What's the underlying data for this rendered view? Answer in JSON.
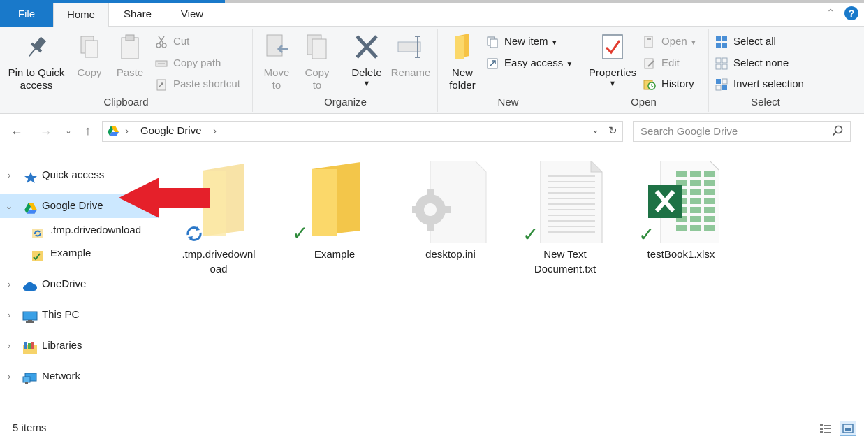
{
  "tabs": {
    "file": "File",
    "home": "Home",
    "share": "Share",
    "view": "View"
  },
  "ribbon": {
    "clipboard": {
      "label": "Clipboard",
      "pin": "Pin to Quick\naccess",
      "copy": "Copy",
      "paste": "Paste",
      "cut": "Cut",
      "copy_path": "Copy path",
      "paste_shortcut": "Paste shortcut"
    },
    "organize": {
      "label": "Organize",
      "move_to": "Move\nto",
      "copy_to": "Copy\nto",
      "delete": "Delete",
      "rename": "Rename"
    },
    "new": {
      "label": "New",
      "new_folder": "New\nfolder",
      "new_item": "New item",
      "easy_access": "Easy access"
    },
    "open": {
      "label": "Open",
      "properties": "Properties",
      "open": "Open",
      "edit": "Edit",
      "history": "History"
    },
    "select": {
      "label": "Select",
      "select_all": "Select all",
      "select_none": "Select none",
      "invert_selection": "Invert selection"
    }
  },
  "address": {
    "crumb": "Google Drive",
    "search_placeholder": "Search Google Drive"
  },
  "nav": {
    "quick_access": "Quick access",
    "google_drive": "Google Drive",
    "tmp": ".tmp.drivedownload",
    "example": "Example",
    "onedrive": "OneDrive",
    "this_pc": "This PC",
    "libraries": "Libraries",
    "network": "Network"
  },
  "files": [
    {
      "name": ".tmp.drivedownl\noad",
      "icon": "folder-syncing-icon"
    },
    {
      "name": "Example",
      "icon": "folder-synced-icon"
    },
    {
      "name": "desktop.ini",
      "icon": "settings-file-icon"
    },
    {
      "name": "New Text\nDocument.txt",
      "icon": "text-file-icon"
    },
    {
      "name": "testBook1.xlsx",
      "icon": "excel-file-icon"
    }
  ],
  "status": {
    "count": "5 items"
  },
  "colors": {
    "accent": "#1979ca",
    "selection": "#cce8ff",
    "ribbon_bg": "#f5f6f7",
    "sync_check": "#2e8b3a",
    "arrow": "#e5202a"
  }
}
